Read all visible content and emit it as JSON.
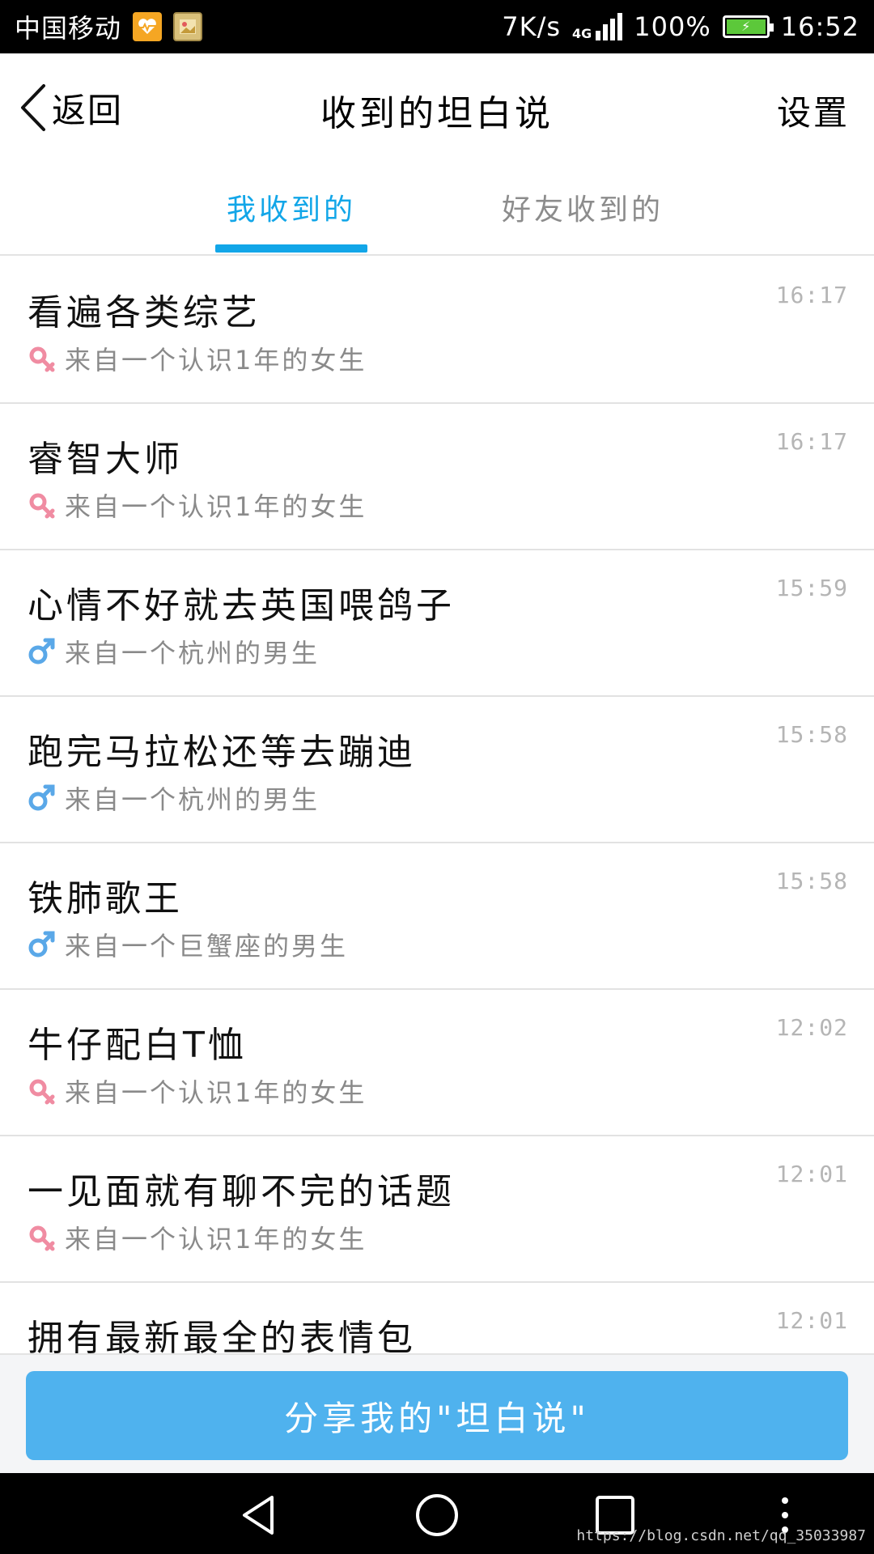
{
  "status_bar": {
    "carrier": "中国移动",
    "app_icons": [
      "health-app-icon",
      "gallery-app-icon"
    ],
    "net_speed": "7K/s",
    "network_type": "4G",
    "battery_percent": "100%",
    "battery_level": 100,
    "time": "16:52"
  },
  "header": {
    "back_label": "返回",
    "title": "收到的坦白说",
    "settings_label": "设置"
  },
  "tabs": [
    {
      "label": "我收到的",
      "active": true
    },
    {
      "label": "好友收到的",
      "active": false
    }
  ],
  "colors": {
    "accent": "#12a6e8",
    "share_button": "#4fb2ee",
    "female_icon": "#f08ca2",
    "male_icon": "#5aa8e8"
  },
  "messages": [
    {
      "title": "看遍各类综艺",
      "time": "16:17",
      "gender": "female",
      "from": "来自一个认识1年的女生"
    },
    {
      "title": "睿智大师",
      "time": "16:17",
      "gender": "female",
      "from": "来自一个认识1年的女生"
    },
    {
      "title": "心情不好就去英国喂鸽子",
      "time": "15:59",
      "gender": "male",
      "from": "来自一个杭州的男生"
    },
    {
      "title": "跑完马拉松还等去蹦迪",
      "time": "15:58",
      "gender": "male",
      "from": "来自一个杭州的男生"
    },
    {
      "title": "铁肺歌王",
      "time": "15:58",
      "gender": "male",
      "from": "来自一个巨蟹座的男生"
    },
    {
      "title": "牛仔配白T恤",
      "time": "12:02",
      "gender": "female",
      "from": "来自一个认识1年的女生"
    },
    {
      "title": "一见面就有聊不完的话题",
      "time": "12:01",
      "gender": "female",
      "from": "来自一个认识1年的女生"
    },
    {
      "title": "拥有最新最全的表情包",
      "time": "12:01",
      "gender": "female",
      "from": ""
    }
  ],
  "share_button_label": "分享我的\"坦白说\"",
  "nav_bar": {
    "buttons": [
      "back-triangle-icon",
      "home-circle-icon",
      "recent-square-icon",
      "menu-dots-icon"
    ]
  },
  "watermark": "https://blog.csdn.net/qq_35033987"
}
